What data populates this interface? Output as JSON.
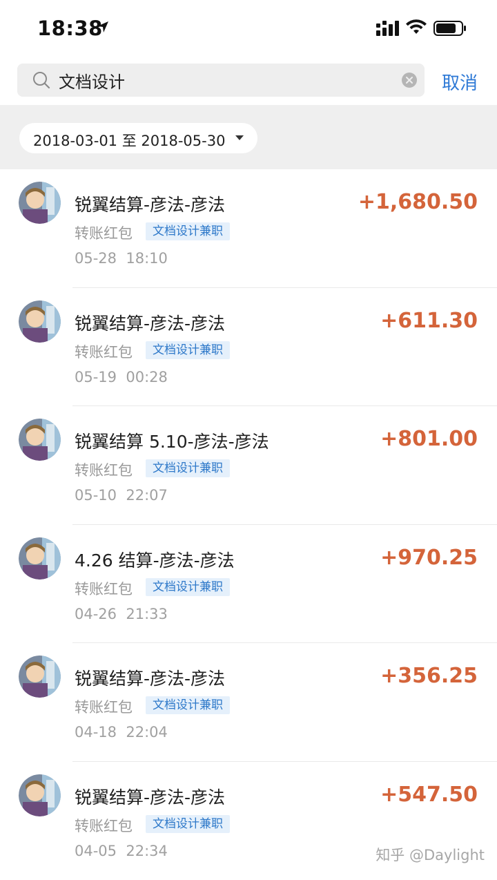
{
  "status_bar": {
    "time": "18:38"
  },
  "search": {
    "value": "文档设计",
    "cancel_label": "取消"
  },
  "filter": {
    "date_range": "2018-03-01 至 2018-05-30"
  },
  "transactions": [
    {
      "title": "锐翼结算-彦法-彦法",
      "category": "转账红包",
      "tag": "文档设计兼职",
      "datetime": "05-28  18:10",
      "amount": "+1,680.50"
    },
    {
      "title": "锐翼结算-彦法-彦法",
      "category": "转账红包",
      "tag": "文档设计兼职",
      "datetime": "05-19  00:28",
      "amount": "+611.30"
    },
    {
      "title": "锐翼结算  5.10-彦法-彦法",
      "category": "转账红包",
      "tag": "文档设计兼职",
      "datetime": "05-10  22:07",
      "amount": "+801.00"
    },
    {
      "title": "4.26 结算-彦法-彦法",
      "category": "转账红包",
      "tag": "文档设计兼职",
      "datetime": "04-26  21:33",
      "amount": "+970.25"
    },
    {
      "title": "锐翼结算-彦法-彦法",
      "category": "转账红包",
      "tag": "文档设计兼职",
      "datetime": "04-18  22:04",
      "amount": "+356.25"
    },
    {
      "title": "锐翼结算-彦法-彦法",
      "category": "转账红包",
      "tag": "文档设计兼职",
      "datetime": "04-05  22:34",
      "amount": "+547.50"
    }
  ],
  "watermark": "知乎 @Daylight",
  "colors": {
    "amount": "#d4643a",
    "link": "#2f7ad6",
    "tag_bg": "#e5f0fb",
    "tag_text": "#2d78c9"
  },
  "icons": {
    "location": "location-arrow-icon",
    "signal": "cellular-signal-icon",
    "wifi": "wifi-icon",
    "battery": "battery-icon",
    "search": "search-icon",
    "clear": "clear-icon",
    "caret": "caret-down-icon"
  }
}
